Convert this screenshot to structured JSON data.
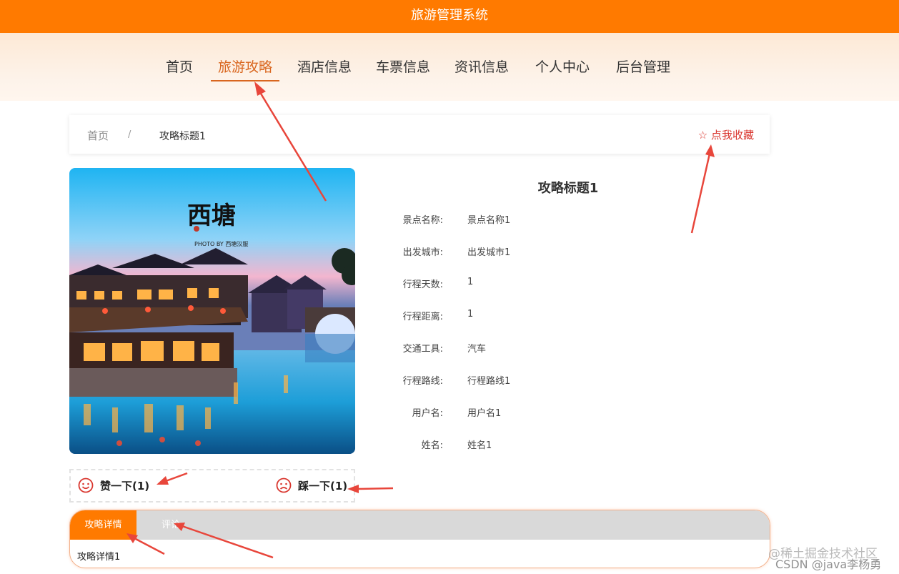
{
  "header": {
    "title": "旅游管理系统"
  },
  "nav": {
    "items": [
      {
        "label": "首页"
      },
      {
        "label": "旅游攻略",
        "active": true
      },
      {
        "label": "酒店信息"
      },
      {
        "label": "车票信息"
      },
      {
        "label": "资讯信息"
      },
      {
        "label": "个人中心"
      },
      {
        "label": "后台管理"
      }
    ]
  },
  "breadcrumb": {
    "home": "首页",
    "separator": "/",
    "current": "攻略标题1"
  },
  "favorite": {
    "icon": "star-outline-icon",
    "label": "点我收藏"
  },
  "photo": {
    "alt": "西塘 water town night scene",
    "caption_calligraphy": "西塘",
    "caption_small": "PHOTO BY 西塘汉服"
  },
  "detail": {
    "title": "攻略标题1",
    "rows": [
      {
        "label": "景点名称:",
        "value": "景点名称1"
      },
      {
        "label": "出发城市:",
        "value": "出发城市1"
      },
      {
        "label": "行程天数:",
        "value": "1"
      },
      {
        "label": "行程距离:",
        "value": "1"
      },
      {
        "label": "交通工具:",
        "value": "汽车"
      },
      {
        "label": "行程路线:",
        "value": "行程路线1"
      },
      {
        "label": "用户名:",
        "value": "用户名1"
      },
      {
        "label": "姓名:",
        "value": "姓名1"
      }
    ]
  },
  "votes": {
    "like": {
      "icon": "smile-icon",
      "label": "赞一下(1)"
    },
    "dislike": {
      "icon": "frown-icon",
      "label": "踩一下(1)"
    }
  },
  "tabs": {
    "items": [
      {
        "label": "攻略详情"
      },
      {
        "label": "评论"
      }
    ],
    "content": "攻略详情1"
  },
  "watermark": {
    "line1": "@稀土掘金技术社区",
    "line2": "CSDN @java李杨勇"
  },
  "colors": {
    "accent": "#ff7a00",
    "nav_active": "#d9661f",
    "favorite": "#d9362e",
    "annotation_arrow": "#e8463b"
  }
}
